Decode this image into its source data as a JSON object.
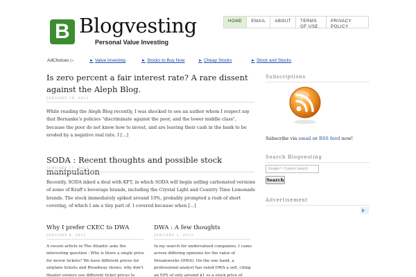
{
  "header": {
    "logo_letter": "B",
    "site_title": "Blogvesting",
    "tagline": "Personal Value Investing"
  },
  "nav": {
    "items": [
      "HOME",
      "EMAIL",
      "ABOUT",
      "TERMS OF USE",
      "PRIVACY POLICY"
    ],
    "active_color": "#e2f0d6"
  },
  "ads": {
    "adchoices_label": "AdChoices",
    "links": [
      "Value Investing",
      "Stocks to Buy Now",
      "Cheap Stocks",
      "Stock and Stocks"
    ]
  },
  "posts": [
    {
      "title": "Is zero percent a fair interest rate? A rare dissent against the Aleph Blog.",
      "date": "JANUARY 18, 2012",
      "excerpt": "While reading the Aleph Blog recently, I was shocked to see an author whom I respect say that Bernanke's policies \"discriminate against the poor, and the lower middle class\", because the poor do not know how to invest, and are leaving their cash in the bank to be eroded by a negative real rate. I […]"
    },
    {
      "title": "SODA : Recent thoughts and possible stock manipulation",
      "date": "JANUARY 17, 2012",
      "excerpt": "Recently, SODA inked a deal with KFT, in which SODA will begin selling carbonated versions of some of Kraft's beverage brands, including the Crystal Light and Country Time Lemonade brands. The stock immediately spiked around 10%, probably prompted a rush of short covering, of which I am a tiny part of. I covered because when […]"
    }
  ],
  "columns": [
    {
      "title": "Why I prefer CKEC to DWA",
      "date": "JANUARY 8, 2012",
      "excerpt": "A recent article in The Atlantic asks the interesting question : Why is there a single price for movie tickets? We have different prices for airplane tickets and Broadway shows; why don't theater owners use different ticket prices to manage demand and keep"
    },
    {
      "title": "DWA : A few thoughts",
      "date": "JANUARY 1, 2012",
      "excerpt": "In my search for undervalued companies, I came across differing opinions for the value of Dreamworks (DWA). On the one hand, a professional analyst has rated DWA a sell, citing an EPS of only around $1 vs a stock price of around $16. On the"
    }
  ],
  "sidebar": {
    "subscriptions_heading": "Subscriptions",
    "subscribe_prefix": "Subscribe via",
    "email_link": "email",
    "or_text": "or",
    "rss_link": "RSS feed",
    "subscribe_suffix": "now!",
    "search_heading": "Search Blogvesting",
    "search_google": "Google™",
    "search_placeholder": "Custom Search",
    "search_button": "Search",
    "ad_heading": "Advertisement",
    "rss_icon": "rss-feed-icon"
  }
}
